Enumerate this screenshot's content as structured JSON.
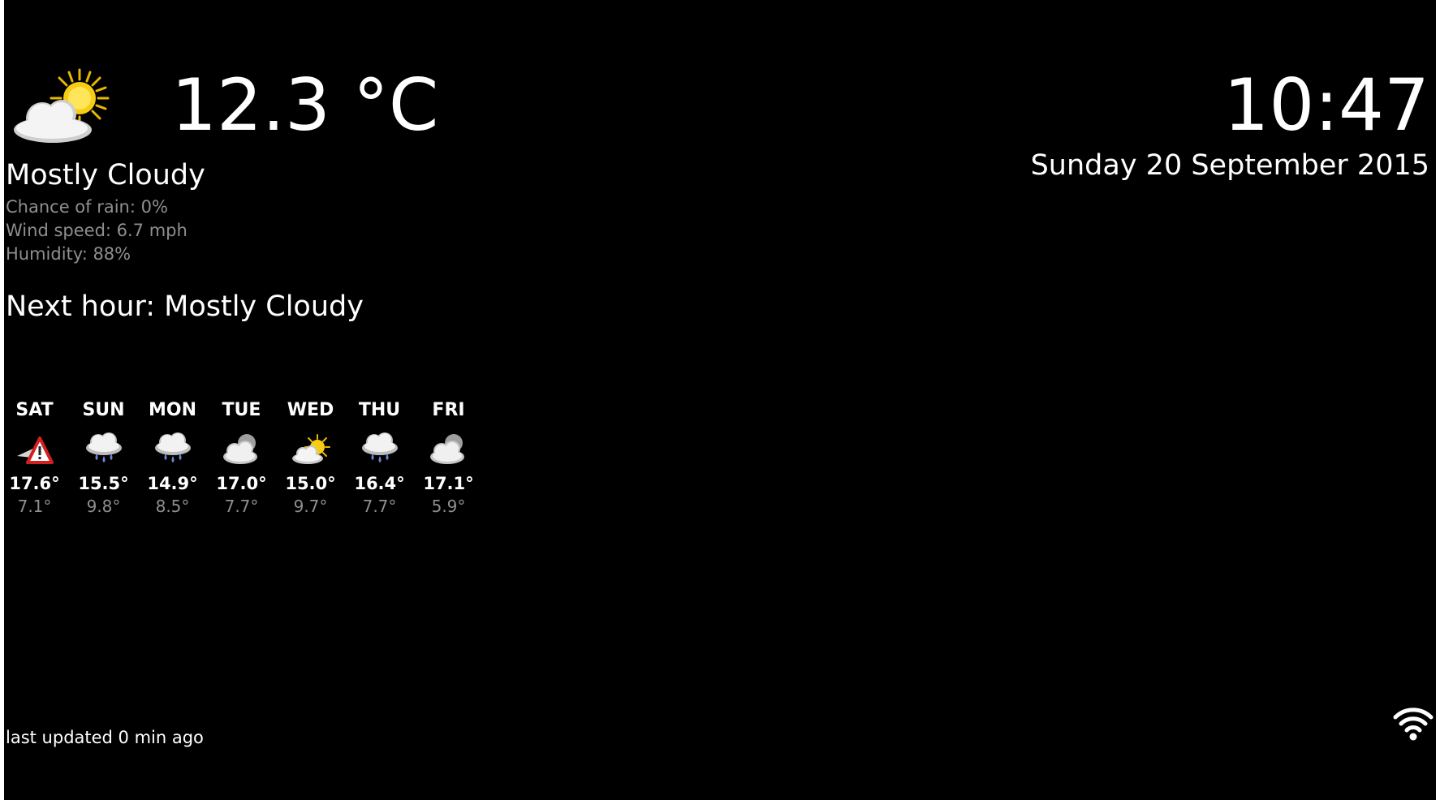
{
  "current": {
    "icon": "partly-cloudy-day-icon",
    "temperature": "12.3 °C",
    "condition": "Mostly Cloudy",
    "chance_of_rain": "Chance of rain: 0%",
    "wind_speed": "Wind speed: 6.7 mph",
    "humidity": "Humidity: 88%",
    "next_hour": "Next hour: Mostly Cloudy"
  },
  "clock": {
    "time": "10:47",
    "date": "Sunday 20 September 2015"
  },
  "forecast": [
    {
      "day": "SAT",
      "icon": "warning-icon",
      "high": "17.6°",
      "low": "7.1°"
    },
    {
      "day": "SUN",
      "icon": "rain-icon",
      "high": "15.5°",
      "low": "9.8°"
    },
    {
      "day": "MON",
      "icon": "rain-icon",
      "high": "14.9°",
      "low": "8.5°"
    },
    {
      "day": "TUE",
      "icon": "cloudy-night-icon",
      "high": "17.0°",
      "low": "7.7°"
    },
    {
      "day": "WED",
      "icon": "partly-cloudy-day-icon",
      "high": "15.0°",
      "low": "9.7°"
    },
    {
      "day": "THU",
      "icon": "rain-icon",
      "high": "16.4°",
      "low": "7.7°"
    },
    {
      "day": "FRI",
      "icon": "cloudy-night-icon",
      "high": "17.1°",
      "low": "5.9°"
    }
  ],
  "footer": {
    "last_updated": "last updated 0 min ago",
    "status_icon": "wifi-icon"
  },
  "colors": {
    "background": "#000000",
    "primary_text": "#ffffff",
    "secondary_text": "#8f8f8f"
  }
}
